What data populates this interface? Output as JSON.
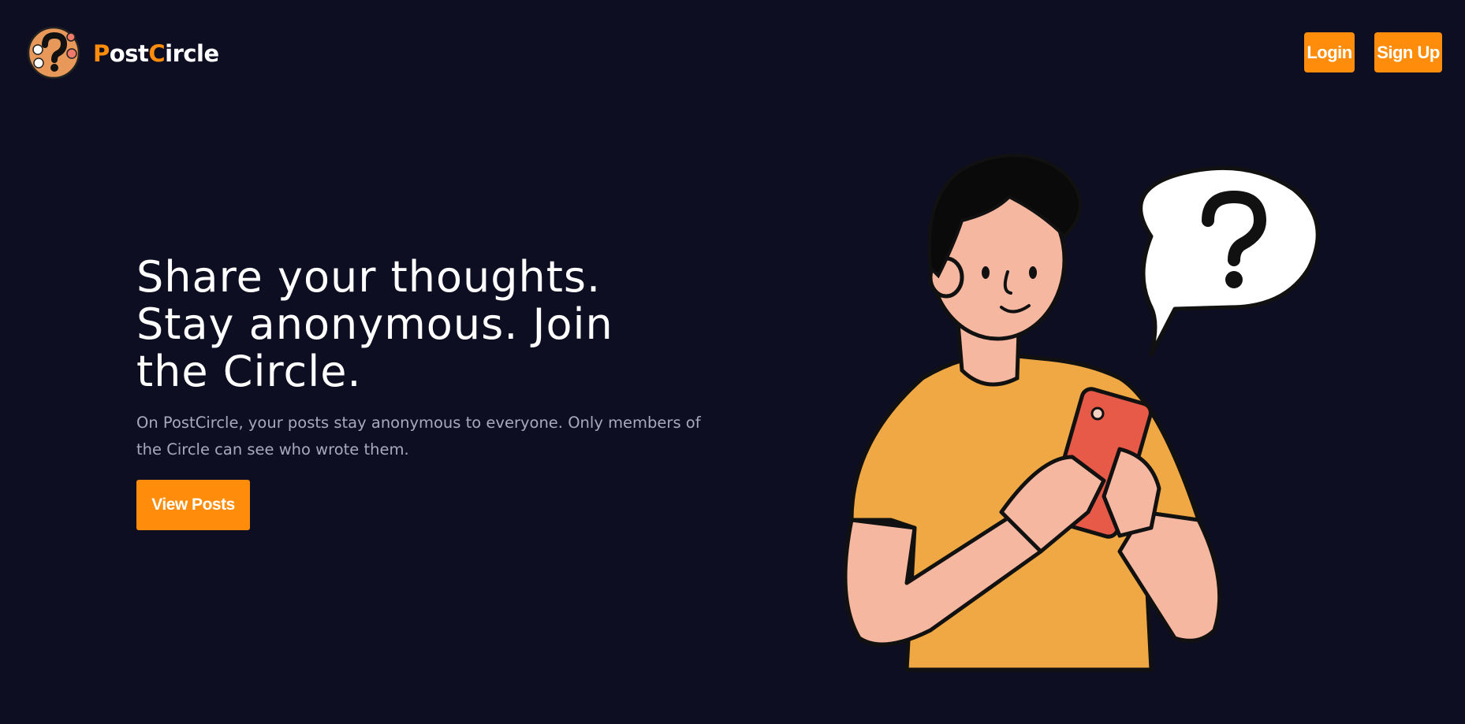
{
  "header": {
    "brand_part1": "P",
    "brand_part2": "ost",
    "brand_part3": "C",
    "brand_part4": "ircle",
    "login_label": "Login",
    "signup_label": "Sign Up"
  },
  "hero": {
    "title": "Share your thoughts. Stay anonymous. Join the Circle.",
    "subtitle": "On PostCircle, your posts stay anonymous to everyone. Only members of the Circle can see who wrote them.",
    "cta_label": "View Posts"
  },
  "colors": {
    "background": "#0e0e22",
    "accent": "#ff8c0a",
    "text": "#ffffff",
    "muted_text": "#a9a9bb"
  },
  "icons": {
    "logo": "question-mark-chat-logo-icon",
    "illustration": "person-with-phone-question-bubble"
  }
}
